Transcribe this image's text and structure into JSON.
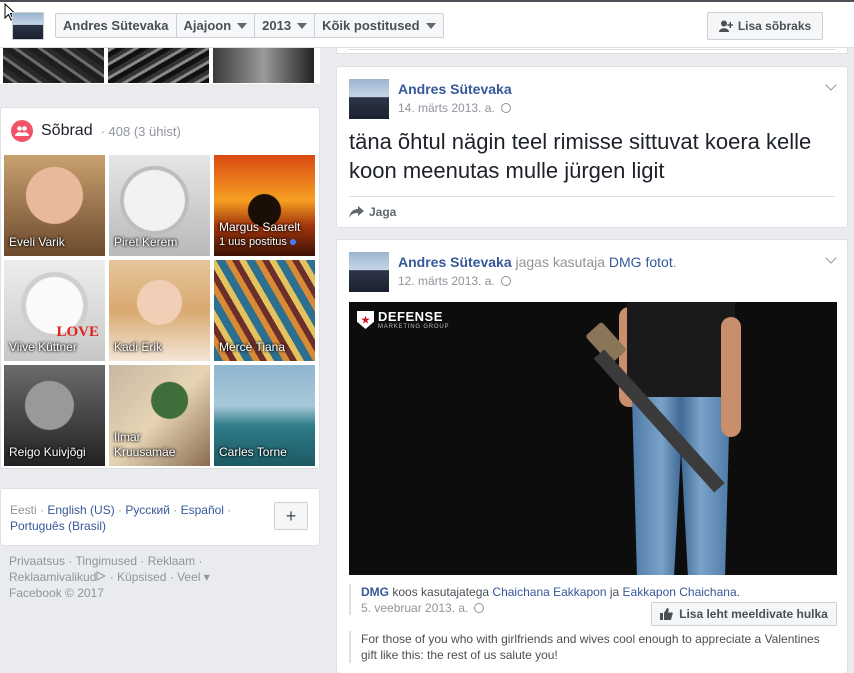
{
  "header": {
    "breadcrumbs": [
      "Andres Sütevaka",
      "Ajajoon",
      "2013",
      "Kõik postitused"
    ],
    "add_friend_label": "Lisa sõbraks"
  },
  "friends": {
    "title": "Sõbrad",
    "count": "· 408 (3 ühist)",
    "items": [
      {
        "name": "Eveli Varik",
        "sub": ""
      },
      {
        "name": "Piret Kerem",
        "sub": ""
      },
      {
        "name": "Margus Saarelt",
        "sub": "1 uus postitus"
      },
      {
        "name": "Viive Küttner",
        "sub": ""
      },
      {
        "name": "Kadi Erik",
        "sub": ""
      },
      {
        "name": "Mercè Tiana",
        "sub": ""
      },
      {
        "name": "Reigo Kuivjõgi",
        "sub": ""
      },
      {
        "name": "Ilmar Kruusamäe",
        "sub": ""
      },
      {
        "name": "Carles Torne",
        "sub": ""
      }
    ],
    "love_text": "LOVE"
  },
  "languages": {
    "current": "Eesti",
    "options": [
      "English (US)",
      "Русский",
      "Español",
      "Português (Brasil)"
    ],
    "add_label": "+"
  },
  "footer": {
    "links": [
      "Privaatsus",
      "Tingimused",
      "Reklaam",
      "Reklaamivalikud",
      "Küpsised",
      "Veel"
    ],
    "copyright": "Facebook © 2017"
  },
  "posts": [
    {
      "author": "Andres Sütevaka",
      "date": "14. märts 2013. a.",
      "text": "täna õhtul nägin teel rimisse sittuvat koera kelle koon meenutas mulle jürgen ligit",
      "share_label": "Jaga"
    },
    {
      "author": "Andres Sütevaka",
      "action": "jagas kasutaja",
      "shared_owner": "DMG",
      "shared_type": "fotot",
      "date": "12. märts 2013. a.",
      "brand_name": "DEFENSE",
      "brand_sub": "MARKETING GROUP",
      "share_source": "DMG",
      "share_with_text": "koos kasutajatega",
      "share_with_1": "Chaichana Eakkapon",
      "share_and": "ja",
      "share_with_2": "Eakkapon Chaichana",
      "share_date": "5. veebruar 2013. a.",
      "like_page_label": "Lisa leht meeldivate hulka",
      "description": "For those of you who with girlfriends and wives cool enough to appreciate a Valentines gift like this: the rest of us salute you!"
    }
  ]
}
